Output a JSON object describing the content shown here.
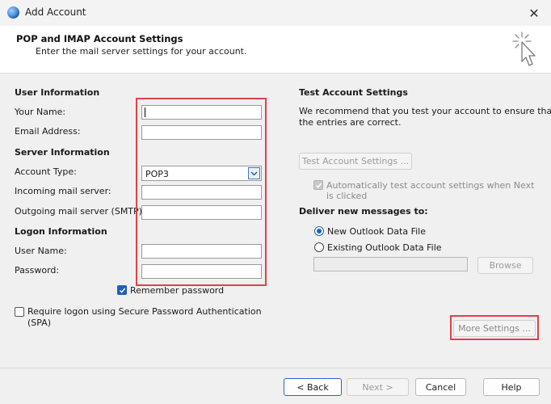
{
  "window": {
    "title": "Add Account"
  },
  "header": {
    "title": "POP and IMAP Account Settings",
    "subtitle": "Enter the mail server settings for your account."
  },
  "left": {
    "user_info_title": "User Information",
    "your_name_label": "Your Name:",
    "your_name_value": "",
    "email_label": "Email Address:",
    "email_value": "",
    "server_info_title": "Server Information",
    "account_type_label": "Account Type:",
    "account_type_value": "POP3",
    "incoming_label": "Incoming mail server:",
    "incoming_value": "",
    "outgoing_label": "Outgoing mail server (SMTP):",
    "outgoing_value": "",
    "logon_info_title": "Logon Information",
    "username_label": "User Name:",
    "username_value": "",
    "password_label": "Password:",
    "password_value": "",
    "remember_password_label": "Remember password",
    "remember_password_checked": true,
    "spa_label_line1": "Require logon using Secure Password Authentication",
    "spa_label_line2": "(SPA)",
    "spa_checked": false
  },
  "right": {
    "test_title": "Test Account Settings",
    "test_desc_line1": "We recommend that you test your account to ensure that",
    "test_desc_line2": "the entries are correct.",
    "test_button": "Test Account Settings ...",
    "auto_test_label_line1": "Automatically test account settings when Next",
    "auto_test_label_line2": "is clicked",
    "deliver_title": "Deliver new messages to:",
    "new_data_file_label": "New Outlook Data File",
    "existing_data_file_label": "Existing Outlook Data File",
    "selected_delivery": "New Outlook Data File",
    "browse_button": "Browse",
    "more_settings_button": "More Settings ..."
  },
  "footer": {
    "back_button": "< Back",
    "next_button": "Next >",
    "cancel_button": "Cancel",
    "help_button": "Help"
  },
  "colors": {
    "highlight_red": "#e0424a",
    "accent_blue": "#1f5fbf"
  },
  "icons": [
    "outlook-globe-icon",
    "close-icon",
    "cursor-click-icon",
    "chevron-down-icon",
    "checkmark-icon"
  ]
}
